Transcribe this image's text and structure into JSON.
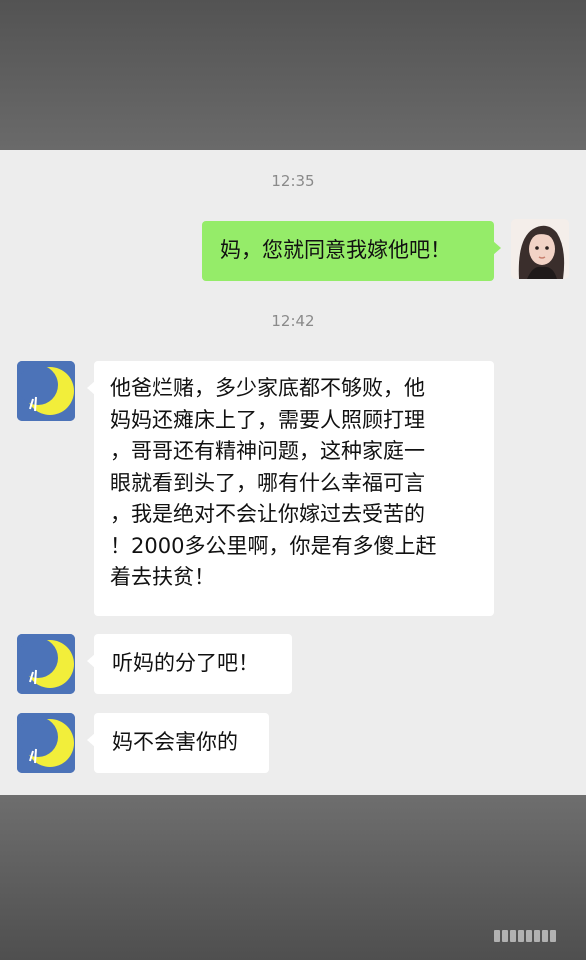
{
  "conversation": {
    "timestamps": [
      "12:35",
      "12:42"
    ],
    "messages": [
      {
        "sender": "user",
        "text": "妈，您就同意我嫁他吧！"
      },
      {
        "sender": "mom",
        "lines": [
          "他爸烂赌，多少家底都不够败，他",
          "妈妈还瘫床上了，需要人照顾打理",
          "，哥哥还有精神问题，这种家庭一",
          "眼就看到头了，哪有什么幸福可言",
          "，我是绝对不会让你嫁过去受苦的",
          "！2000多公里啊，你是有多傻上赶",
          "着去扶贫！"
        ]
      },
      {
        "sender": "mom",
        "text": "听妈的分了吧！"
      },
      {
        "sender": "mom",
        "text": "妈不会害你的"
      }
    ]
  },
  "avatars": {
    "mom": {
      "icon": "crescent-moon-icon",
      "background": "#4c73b8",
      "moon_color": "#f2ee3a"
    },
    "user": {
      "icon": "girl-photo-avatar"
    }
  },
  "colors": {
    "chat_background": "#ededed",
    "sent_bubble": "#95ec69",
    "received_bubble": "#ffffff"
  }
}
